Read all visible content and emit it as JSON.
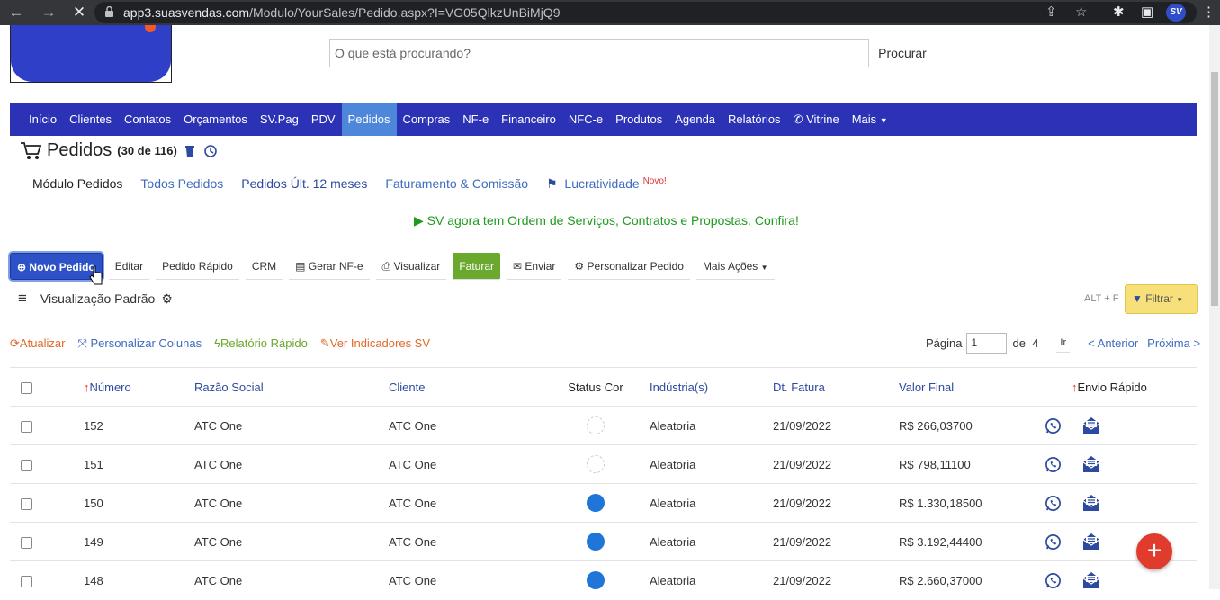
{
  "browser": {
    "host": "app3.suasvendas.com",
    "path": "/Modulo/YourSales/Pedido.aspx?I=VG05QlkzUnBiMjQ9",
    "profile": "SV"
  },
  "search": {
    "placeholder": "O que está procurando?",
    "button": "Procurar"
  },
  "menu": [
    "Início",
    "Clientes",
    "Contatos",
    "Orçamentos",
    "SV.Pag",
    "PDV",
    "Pedidos",
    "Compras",
    "NF-e",
    "Financeiro",
    "NFC-e",
    "Produtos",
    "Agenda",
    "Relatórios",
    "Vitrine",
    "Mais"
  ],
  "page": {
    "title": "Pedidos",
    "count": "(30 de 116)"
  },
  "subnav": {
    "modulo": "Módulo Pedidos",
    "todos": "Todos Pedidos",
    "ult12": "Pedidos Últ. 12 meses",
    "faturamento": "Faturamento & Comissão",
    "lucratividade": "Lucratividade",
    "novo": "Novo!"
  },
  "banner": "SV agora tem Ordem de Serviços, Contratos e Propostas. Confira!",
  "toolbar": {
    "novo": "Novo Pedido",
    "editar": "Editar",
    "rapido": "Pedido Rápido",
    "crm": "CRM",
    "nfe": "Gerar NF-e",
    "visualizar": "Visualizar",
    "faturar": "Faturar",
    "enviar": "Enviar",
    "personalizar": "Personalizar Pedido",
    "mais": "Mais Ações"
  },
  "view": {
    "label": "Visualização Padrão",
    "shortcut": "ALT + F",
    "filtrar": "Filtrar"
  },
  "actions": {
    "atualizar": "Atualizar",
    "colunas": "Personalizar Colunas",
    "relatorio": "Relatório Rápido",
    "indicadores": "Ver Indicadores SV"
  },
  "pager": {
    "pagina": "Página",
    "current": "1",
    "de": "de",
    "total": "4",
    "ir": "Ir",
    "anterior": "< Anterior",
    "proxima": "Próxima >"
  },
  "columns": {
    "numero": "Número",
    "razao": "Razão Social",
    "cliente": "Cliente",
    "status": "Status Cor",
    "industria": "Indústria(s)",
    "dt": "Dt. Fatura",
    "valor": "Valor Final",
    "envio": "Envio Rápido"
  },
  "rows": [
    {
      "numero": "152",
      "razao": "ATC One",
      "cliente": "ATC One",
      "industria": "Aleatoria",
      "dt": "21/09/2022",
      "valor": "R$ 266,03700",
      "status": "none"
    },
    {
      "numero": "151",
      "razao": "ATC One",
      "cliente": "ATC One",
      "industria": "Aleatoria",
      "dt": "21/09/2022",
      "valor": "R$ 798,11100",
      "status": "none"
    },
    {
      "numero": "150",
      "razao": "ATC One",
      "cliente": "ATC One",
      "industria": "Aleatoria",
      "dt": "21/09/2022",
      "valor": "R$ 1.330,18500",
      "status": "#2075d8"
    },
    {
      "numero": "149",
      "razao": "ATC One",
      "cliente": "ATC One",
      "industria": "Aleatoria",
      "dt": "21/09/2022",
      "valor": "R$ 3.192,44400",
      "status": "#2075d8"
    },
    {
      "numero": "148",
      "razao": "ATC One",
      "cliente": "ATC One",
      "industria": "Aleatoria",
      "dt": "21/09/2022",
      "valor": "R$ 2.660,37000",
      "status": "#2075d8"
    }
  ]
}
